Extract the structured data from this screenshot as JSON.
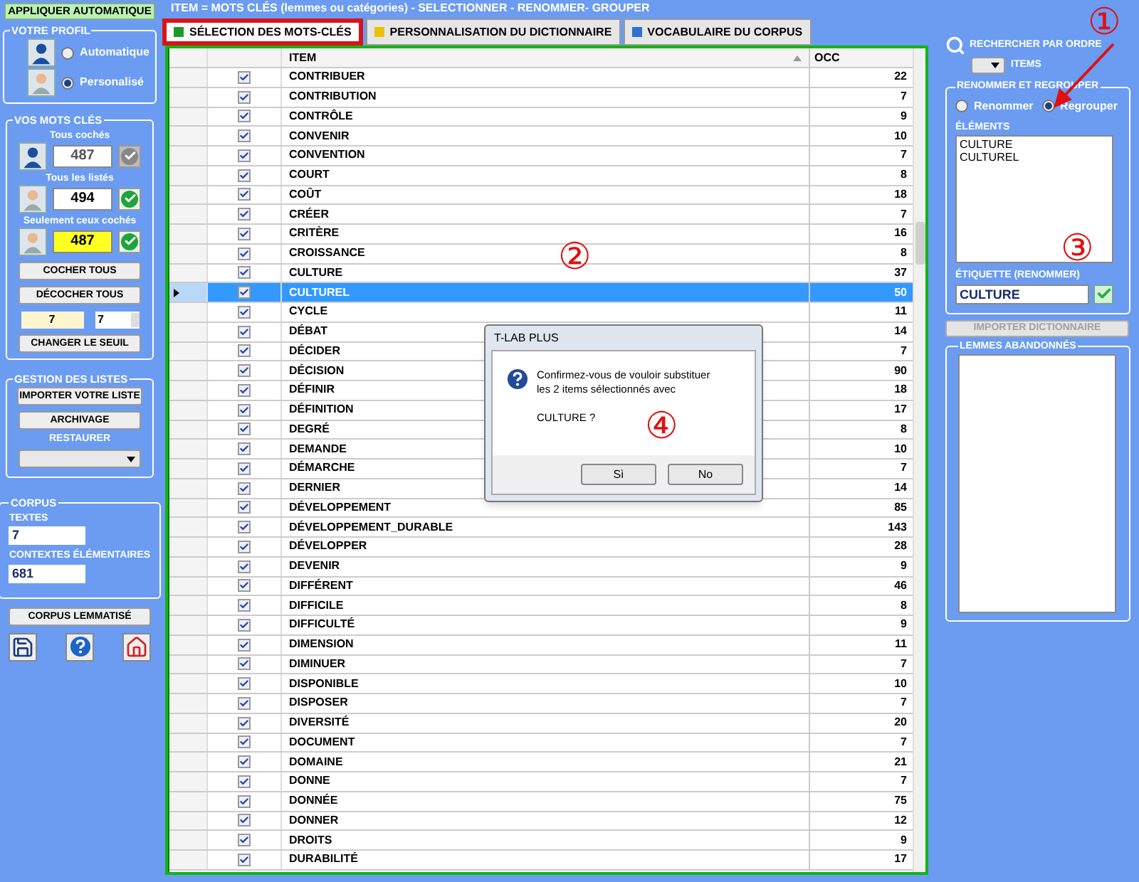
{
  "header_title": "ITEM  = MOTS CLÉS (lemmes ou catégories) - SELECTIONNER - RENOMMER- GROUPER",
  "left_panel": {
    "apply_button": "APPLIQUER AUTOMATIQUE",
    "profile": {
      "title": "VOTRE PROFIL",
      "options": [
        {
          "label": "Automatique",
          "selected": false
        },
        {
          "label": "Personalisé",
          "selected": true
        }
      ]
    },
    "keywords": {
      "title": "VOS MOTS CLÉS",
      "counters": [
        {
          "label": "Tous cochés",
          "value": "487",
          "highlighted": false,
          "confirmed": false
        },
        {
          "label": "Tous les listés",
          "value": "494",
          "highlighted": false,
          "confirmed": true
        },
        {
          "label": "Seulement ceux cochés",
          "value": "487",
          "highlighted": true,
          "confirmed": true
        }
      ],
      "check_all": "COCHER TOUS",
      "uncheck_all": "DÉCOCHER TOUS",
      "threshold": "7",
      "threshold_spinner": "7",
      "change_threshold": "CHANGER LE SEUIL"
    },
    "lists": {
      "title": "GESTION DES LISTES",
      "import": "IMPORTER VOTRE LISTE",
      "archive": "ARCHIVAGE",
      "restore_label": "RESTAURER"
    },
    "corpus": {
      "title": "CORPUS",
      "texts_label": "TEXTES",
      "texts": "7",
      "contexts_label": "CONTEXTES ÉLÉMENTAIRES",
      "contexts": "681"
    },
    "lemmatized_button": "CORPUS LEMMATISÉ"
  },
  "tabs": [
    {
      "label": "SÉLECTION DES MOTS-CLÉS",
      "selected": true,
      "color": "#1a9a2a"
    },
    {
      "label": "PERSONNALISATION DU DICTIONNAIRE",
      "selected": false,
      "color": "#f0c000"
    },
    {
      "label": "VOCABULAIRE DU CORPUS",
      "selected": false,
      "color": "#3070d0"
    }
  ],
  "table": {
    "columns": [
      "ITEM",
      "OCC"
    ],
    "rows": [
      {
        "checked": true,
        "item": "CONTRIBUER",
        "occ": "22",
        "selected": false
      },
      {
        "checked": true,
        "item": "CONTRIBUTION",
        "occ": "7",
        "selected": false
      },
      {
        "checked": true,
        "item": "CONTRÔLE",
        "occ": "9",
        "selected": false
      },
      {
        "checked": true,
        "item": "CONVENIR",
        "occ": "10",
        "selected": false
      },
      {
        "checked": true,
        "item": "CONVENTION",
        "occ": "7",
        "selected": false
      },
      {
        "checked": true,
        "item": "COURT",
        "occ": "8",
        "selected": false
      },
      {
        "checked": true,
        "item": "COÛT",
        "occ": "18",
        "selected": false
      },
      {
        "checked": true,
        "item": "CRÉER",
        "occ": "7",
        "selected": false
      },
      {
        "checked": true,
        "item": "CRITÈRE",
        "occ": "16",
        "selected": false
      },
      {
        "checked": true,
        "item": "CROISSANCE",
        "occ": "8",
        "selected": false
      },
      {
        "checked": true,
        "item": "CULTURE",
        "occ": "37",
        "selected": false
      },
      {
        "checked": true,
        "item": "CULTUREL",
        "occ": "50",
        "selected": true
      },
      {
        "checked": true,
        "item": "CYCLE",
        "occ": "11",
        "selected": false
      },
      {
        "checked": true,
        "item": "DÉBAT",
        "occ": "14",
        "selected": false
      },
      {
        "checked": true,
        "item": "DÉCIDER",
        "occ": "7",
        "selected": false
      },
      {
        "checked": true,
        "item": "DÉCISION",
        "occ": "90",
        "selected": false
      },
      {
        "checked": true,
        "item": "DÉFINIR",
        "occ": "18",
        "selected": false
      },
      {
        "checked": true,
        "item": "DÉFINITION",
        "occ": "17",
        "selected": false
      },
      {
        "checked": true,
        "item": "DEGRÉ",
        "occ": "8",
        "selected": false
      },
      {
        "checked": true,
        "item": "DEMANDE",
        "occ": "10",
        "selected": false
      },
      {
        "checked": true,
        "item": "DÉMARCHE",
        "occ": "7",
        "selected": false
      },
      {
        "checked": true,
        "item": "DERNIER",
        "occ": "14",
        "selected": false
      },
      {
        "checked": true,
        "item": "DÉVELOPPEMENT",
        "occ": "85",
        "selected": false
      },
      {
        "checked": true,
        "item": "DÉVELOPPEMENT_DURABLE",
        "occ": "143",
        "selected": false
      },
      {
        "checked": true,
        "item": "DÉVELOPPER",
        "occ": "28",
        "selected": false
      },
      {
        "checked": true,
        "item": "DEVENIR",
        "occ": "9",
        "selected": false
      },
      {
        "checked": true,
        "item": "DIFFÉRENT",
        "occ": "46",
        "selected": false
      },
      {
        "checked": true,
        "item": "DIFFICILE",
        "occ": "8",
        "selected": false
      },
      {
        "checked": true,
        "item": "DIFFICULTÉ",
        "occ": "9",
        "selected": false
      },
      {
        "checked": true,
        "item": "DIMENSION",
        "occ": "11",
        "selected": false
      },
      {
        "checked": true,
        "item": "DIMINUER",
        "occ": "7",
        "selected": false
      },
      {
        "checked": true,
        "item": "DISPONIBLE",
        "occ": "10",
        "selected": false
      },
      {
        "checked": true,
        "item": "DISPOSER",
        "occ": "7",
        "selected": false
      },
      {
        "checked": true,
        "item": "DIVERSITÉ",
        "occ": "20",
        "selected": false
      },
      {
        "checked": true,
        "item": "DOCUMENT",
        "occ": "7",
        "selected": false
      },
      {
        "checked": true,
        "item": "DOMAINE",
        "occ": "21",
        "selected": false
      },
      {
        "checked": true,
        "item": "DONNE",
        "occ": "7",
        "selected": false
      },
      {
        "checked": true,
        "item": "DONNÉE",
        "occ": "75",
        "selected": false
      },
      {
        "checked": true,
        "item": "DONNER",
        "occ": "12",
        "selected": false
      },
      {
        "checked": true,
        "item": "DROITS",
        "occ": "9",
        "selected": false
      },
      {
        "checked": true,
        "item": "DURABILITÉ",
        "occ": "17",
        "selected": false
      }
    ]
  },
  "right_panel": {
    "search_label": "RECHERCHER PAR ORDRE",
    "order_label": "ITEMS",
    "group": {
      "title": "RENOMMER ET REGROUPER",
      "options": [
        {
          "label": "Renommer",
          "selected": false
        },
        {
          "label": "Regrouper",
          "selected": true
        }
      ],
      "elements_label": "ÉLÉMENTS",
      "elements": [
        "CULTURE",
        "CULTUREL"
      ],
      "label_title": "ÉTIQUETTE (RENOMMER)",
      "label_value": "CULTURE"
    },
    "import_dictionary": {
      "label": "IMPORTER DICTIONNAIRE",
      "disabled": true
    },
    "abandoned_title": "LEMMES ABANDONNÉS"
  },
  "dialog": {
    "title": "T-LAB PLUS",
    "message": "Confirmez-vous de vouloir substituer les 2 items sélectionnés avec",
    "question": "CULTURE ?",
    "buttons": [
      "Sì",
      "No"
    ]
  },
  "annotations": [
    "①",
    "②",
    "③",
    "④"
  ]
}
